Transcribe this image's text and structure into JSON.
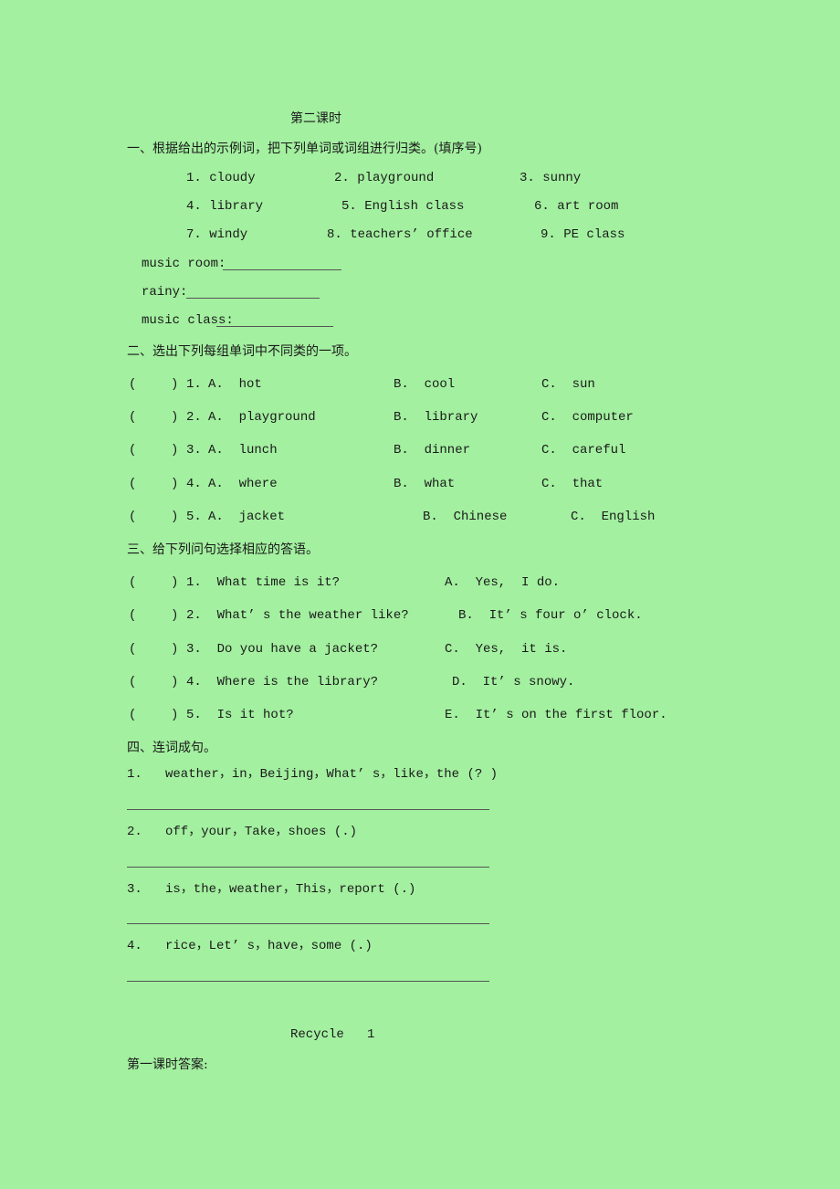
{
  "page": {
    "background": "#a3f0a0"
  },
  "lesson_title": "第二课时",
  "section1": {
    "heading": "一、根据给出的示例词，把下列单词或词组进行归类。(填序号)",
    "words": [
      "1. cloudy",
      "2. playground",
      "3. sunny",
      "4. library",
      "5. English class",
      "6. art room",
      "7. windy",
      "8. teachers’ office",
      "9. PE class"
    ],
    "categories": [
      "music room:",
      "rainy:",
      "music class:"
    ]
  },
  "section2": {
    "heading": "二、选出下列每组单词中不同类的一项。",
    "items": [
      {
        "num": "1.",
        "a": "A.  hot",
        "b": "B.  cool",
        "c": "C.  sun"
      },
      {
        "num": "2.",
        "a": "A.  playground",
        "b": "B.  library",
        "c": "C.  computer"
      },
      {
        "num": "3.",
        "a": "A.  lunch",
        "b": "B.  dinner",
        "c": "C.  careful"
      },
      {
        "num": "4.",
        "a": "A.  where",
        "b": "B.  what",
        "c": "C.  that"
      },
      {
        "num": "5.",
        "a": "A.  jacket",
        "b": "B.  Chinese",
        "c": "C.  English"
      }
    ]
  },
  "section3": {
    "heading": "三、给下列问句选择相应的答语。",
    "items": [
      {
        "q": "1.  What time is it?",
        "a": "A.  Yes,  I do."
      },
      {
        "q": "2.  What’ s the weather like?",
        "a": "B.  It’ s four o’ clock."
      },
      {
        "q": "3.  Do you have a jacket?",
        "a": "C.  Yes,  it is."
      },
      {
        "q": "4.  Where is the library?",
        "a": "D.  It’ s snowy."
      },
      {
        "q": "5.  Is it hot?",
        "a": "E.  It’ s on the first floor."
      }
    ]
  },
  "section4": {
    "heading": "四、连词成句。",
    "items": [
      "1.   weather，in，Beijing，What’ s，like，the (? )",
      "2.   off，your，Take，shoes (.)",
      "3.   is，the，weather，This，report (.)",
      "4.   rice，Let’ s，have，some (.)"
    ]
  },
  "recycle_title": "Recycle   1",
  "answer_heading": "第一课时答案:"
}
